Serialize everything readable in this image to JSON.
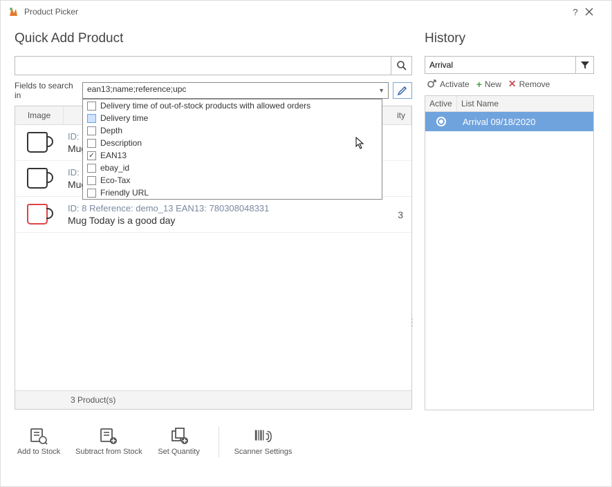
{
  "window": {
    "title": "Product Picker"
  },
  "left": {
    "heading": "Quick Add Product",
    "search_value": "",
    "fields_label": "Fields to search in",
    "fields_value": "ean13;name;reference;upc",
    "dropdown_options": [
      {
        "label": "Delivery time of out-of-stock products with allowed orders",
        "checked": false,
        "hl": false
      },
      {
        "label": "Delivery time",
        "checked": false,
        "hl": true
      },
      {
        "label": "Depth",
        "checked": false,
        "hl": false
      },
      {
        "label": "Description",
        "checked": false,
        "hl": false
      },
      {
        "label": "EAN13",
        "checked": true,
        "hl": false
      },
      {
        "label": "ebay_id",
        "checked": false,
        "hl": false
      },
      {
        "label": "Eco-Tax",
        "checked": false,
        "hl": false
      },
      {
        "label": "Friendly URL",
        "checked": false,
        "hl": false
      }
    ],
    "grid": {
      "headers": {
        "image": "Image",
        "name": "",
        "qty": "ity"
      },
      "rows": [
        {
          "idline": "ID:",
          "name": "Mug",
          "qty": ""
        },
        {
          "idline": "ID:",
          "name": "Mug",
          "qty": ""
        },
        {
          "idline": "ID: 8 Reference: demo_13 EAN13: 780308048331",
          "name": "Mug Today is a good day",
          "qty": "3"
        }
      ],
      "footer": "3 Product(s)"
    }
  },
  "right": {
    "heading": "History",
    "search_value": "Arrival",
    "toolbar": {
      "activate": "Activate",
      "new": "New",
      "remove": "Remove"
    },
    "grid": {
      "headers": {
        "active": "Active",
        "name": "List Name"
      },
      "rows": [
        {
          "active": true,
          "name": "Arrival 09/18/2020"
        }
      ]
    }
  },
  "bottom": {
    "add": "Add to Stock",
    "subtract": "Subtract from Stock",
    "setqty": "Set Quantity",
    "scanner": "Scanner Settings"
  }
}
